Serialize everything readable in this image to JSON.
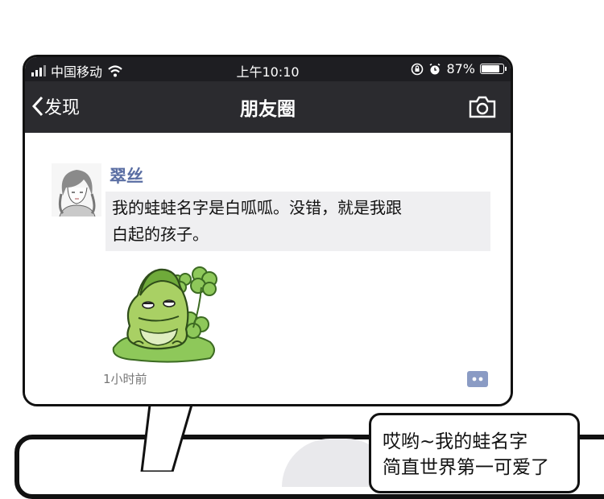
{
  "status_bar": {
    "carrier": "中国移动",
    "time": "上午10:10",
    "battery": "87%",
    "battery_level": 0.87
  },
  "navbar": {
    "back_label": "发现",
    "title": "朋友圈"
  },
  "post": {
    "author": "翠丝",
    "text_line1": "我的蛙蛙名字是白呱呱。没错，就是我跟",
    "text_line2": "白起的孩子。",
    "time": "1小时前"
  },
  "speech_bubble": {
    "line1": "哎哟~我的蛙名字",
    "line2": "简直世界第一可爱了"
  },
  "icons": {
    "signal": "signal-icon",
    "wifi": "wifi-icon",
    "alarm": "alarm-icon",
    "rotation_lock": "rotation-lock-icon",
    "camera": "camera-icon",
    "comment": "comment-icon",
    "back": "chevron-left-icon"
  }
}
